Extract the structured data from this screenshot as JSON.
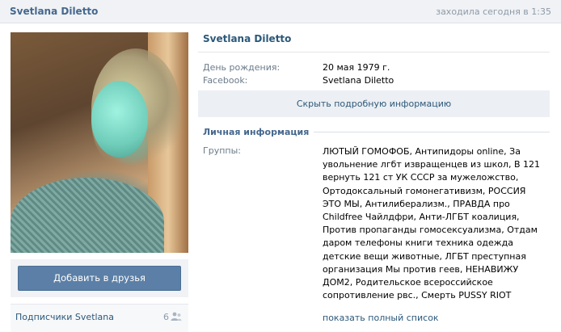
{
  "header": {
    "name": "Svetlana Diletto",
    "status": "заходила сегодня в 1:35"
  },
  "left": {
    "add_friend_label": "Добавить в друзья",
    "subscribers_label": "Подписчики Svetlana",
    "subscribers_count": "6",
    "subscribers_icon": "people-icon"
  },
  "profile": {
    "name": "Svetlana Diletto",
    "birthday_label": "День рождения:",
    "birthday_value": "20 мая 1979 г.",
    "facebook_label": "Facebook:",
    "facebook_value": "Svetlana Diletto",
    "hide_details_label": "Скрыть подробную информацию",
    "personal_info_title": "Личная информация",
    "groups_label": "Группы:",
    "groups_value": "ЛЮТЫЙ ГОМОФОБ, Антипидоры online, За увольнение лгбт извращенцев из школ, В 121 вернуть 121 ст УК СССР за мужеложство, Ортодоксальный гомонегативизм, РОССИЯ ЭТО МЫ, Антилиберализм., ПРАВДА про Childfree Чайлдфри, Анти-ЛГБТ коалиция, Против пропаганды гомосексуализма, Отдам даром телефоны книги техника одежда детские вещи животные, ЛГБТ преступная организация Мы против геев, НЕНАВИЖУ ДОМ2, Родительское всероссийское сопротивление рвс., Смерть PUSSY RIOT",
    "show_full_list_label": "показать полный список"
  },
  "colors": {
    "link": "#2b587a",
    "button": "#5b7fa6",
    "header_bg": "#f0f2f5"
  }
}
